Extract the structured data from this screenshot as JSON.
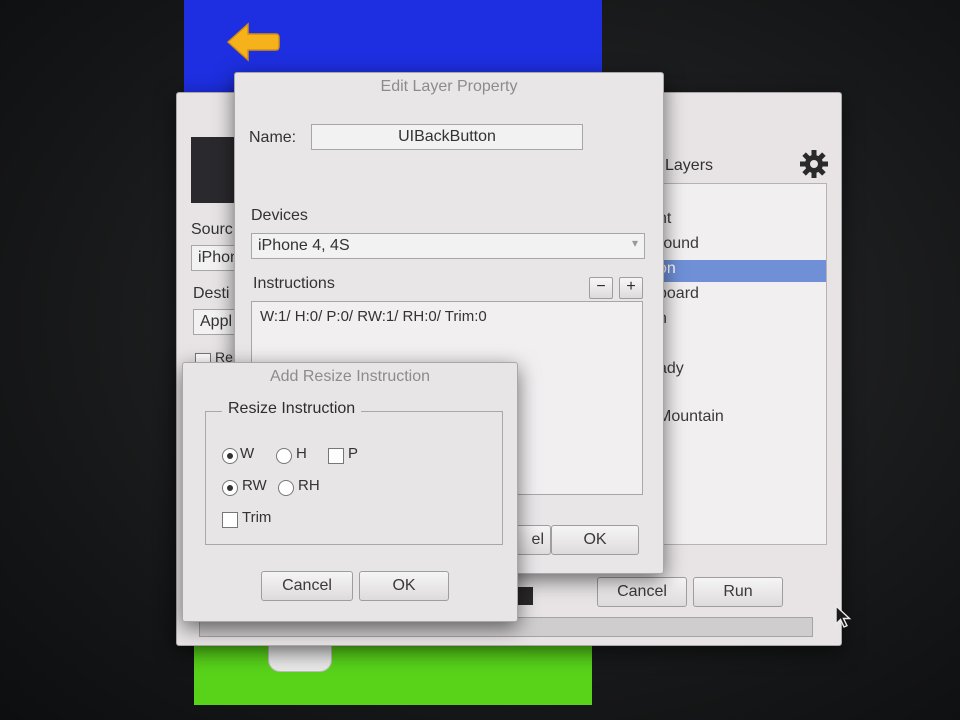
{
  "edit_window": {
    "title": "Edit Layer Property",
    "name_label": "Name:",
    "name_value": "UIBackButton",
    "devices_label": "Devices",
    "device_selected": "iPhone 4, 4S",
    "instructions_label": "Instructions",
    "remove_symbol": "−",
    "add_symbol": "+",
    "instructions": [
      "W:1/ H:0/ P:0/ RW:1/ RH:0/ Trim:0"
    ],
    "cancel_label_partial": "el",
    "ok_label": "OK"
  },
  "resize_window": {
    "title": "Add Resize Instruction",
    "group_label": "Resize Instruction",
    "options": {
      "w": {
        "label": "W",
        "selected": true
      },
      "h": {
        "label": "H",
        "selected": false
      },
      "p": {
        "label": "P",
        "checked": false
      },
      "rw": {
        "label": "RW",
        "selected": true
      },
      "rh": {
        "label": "RH",
        "selected": false
      },
      "trim": {
        "label": "Trim",
        "checked": false
      }
    },
    "cancel_label": "Cancel",
    "ok_label": "OK"
  },
  "main_window": {
    "source_label": "Sourc",
    "source_value": "iPhon",
    "destination_label": "Desti",
    "destination_value": "Appl",
    "checkbox_partial": "Re",
    "layers_title": "Layers",
    "layers": [
      "ht",
      "round",
      "on",
      "board",
      "n",
      "ady",
      "Mountain"
    ],
    "cancel_label": "Cancel",
    "run_label": "Run"
  },
  "colors": {
    "blue_canvas": "#1d2fe0",
    "green_canvas": "#58d31a",
    "arrow": "#f6b21a",
    "selection": "#6f8fd6"
  }
}
